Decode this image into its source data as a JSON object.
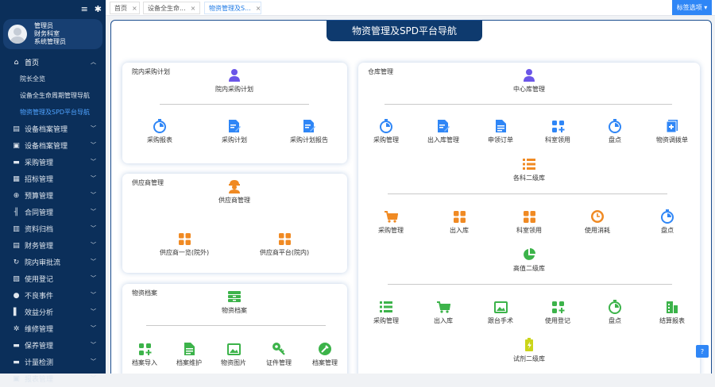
{
  "sidebar": {
    "user": {
      "name": "管理员",
      "dept": "财务科室",
      "role": "系统管理员"
    },
    "items": [
      {
        "label": "首页",
        "icon": "home-icon",
        "glyph": "⌂"
      },
      {
        "label": "设备档案管理",
        "icon": "archive-icon",
        "glyph": "▤"
      },
      {
        "label": "设备档案管理",
        "icon": "file-icon",
        "glyph": "▣"
      },
      {
        "label": "采购管理",
        "icon": "cart-icon",
        "glyph": "▬"
      },
      {
        "label": "招标管理",
        "icon": "gavel-icon",
        "glyph": "▦"
      },
      {
        "label": "预算管理",
        "icon": "budget-icon",
        "glyph": "⊕"
      },
      {
        "label": "合同管理",
        "icon": "contract-icon",
        "glyph": "╢"
      },
      {
        "label": "资料归档",
        "icon": "folder-icon",
        "glyph": "▥"
      },
      {
        "label": "财务管理",
        "icon": "finance-icon",
        "glyph": "▤"
      },
      {
        "label": "院内审批流",
        "icon": "flow-icon",
        "glyph": "↻"
      },
      {
        "label": "使用登记",
        "icon": "register-icon",
        "glyph": "▧"
      },
      {
        "label": "不良事件",
        "icon": "alert-icon",
        "glyph": "●"
      },
      {
        "label": "效益分析",
        "icon": "chart-icon",
        "glyph": "▌"
      },
      {
        "label": "维修管理",
        "icon": "wrench-icon",
        "glyph": "✲"
      },
      {
        "label": "保养管理",
        "icon": "maintain-icon",
        "glyph": "▬"
      },
      {
        "label": "计量检测",
        "icon": "measure-icon",
        "glyph": "▬"
      },
      {
        "label": "报表管理",
        "icon": "report-icon",
        "glyph": "▣"
      }
    ],
    "home_subs": [
      {
        "label": "院长全览"
      },
      {
        "label": "设备全生命周期管理导航"
      },
      {
        "label": "物资管理及SPD平台导航"
      }
    ]
  },
  "tabs": [
    {
      "label": "首页"
    },
    {
      "label": "设备全生命..."
    },
    {
      "label": "物资管理及S..."
    }
  ],
  "top_button": "标签选项",
  "page_title": "物资管理及SPD平台导航",
  "help_label": "帮助",
  "colors": {
    "blue": "#2f86f6",
    "purple": "#6b56e8",
    "orange": "#f08a23",
    "green": "#3cb34a",
    "yellow": "#cbd51a",
    "sidebar": "#0b2f5a"
  },
  "cards": {
    "plan": {
      "title": "院内采购计划",
      "head": {
        "label": "院内采购计划",
        "icon": "user-icon"
      },
      "row": [
        {
          "label": "采购报表",
          "icon": "timer-icon"
        },
        {
          "label": "采购计划",
          "icon": "doc-edit-icon"
        },
        {
          "label": "采购计划报告",
          "icon": "doc-edit-icon"
        }
      ]
    },
    "supplier": {
      "title": "供应商管理",
      "head": {
        "label": "供应商管理",
        "icon": "worker-icon"
      },
      "row": [
        {
          "label": "供应商一览(院外)",
          "icon": "grid-icon"
        },
        {
          "label": "供应商平台(院内)",
          "icon": "grid-icon"
        }
      ]
    },
    "dict": {
      "title": "物资档案",
      "head": {
        "label": "物资档案",
        "icon": "archive-box-icon"
      },
      "row": [
        {
          "label": "档案导入",
          "icon": "apps-icon"
        },
        {
          "label": "档案维护",
          "icon": "doc-icon"
        },
        {
          "label": "物资图片",
          "icon": "image-icon"
        },
        {
          "label": "证件管理",
          "icon": "key-icon"
        },
        {
          "label": "档案管理",
          "icon": "tool-icon"
        }
      ]
    },
    "warehouse": {
      "title": "仓库管理",
      "head": {
        "label": "中心库管理",
        "icon": "user-icon"
      },
      "row1": [
        {
          "label": "采购管理",
          "icon": "timer-icon"
        },
        {
          "label": "出入库管理",
          "icon": "doc-edit-icon"
        },
        {
          "label": "申领订单",
          "icon": "doc-icon"
        },
        {
          "label": "科室领用",
          "icon": "apps-icon"
        },
        {
          "label": "盘点",
          "icon": "timer-icon"
        },
        {
          "label": "物资调拨单",
          "icon": "plus-doc-icon"
        }
      ],
      "sec2": {
        "label": "各科二级库",
        "icon": "list-icon"
      },
      "row2": [
        {
          "label": "采购管理",
          "icon": "cart-icon"
        },
        {
          "label": "出入库",
          "icon": "grid-icon"
        },
        {
          "label": "科室领用",
          "icon": "grid-icon"
        },
        {
          "label": "使用消耗",
          "icon": "clock-icon"
        },
        {
          "label": "盘点",
          "icon": "timer-icon"
        }
      ],
      "sec3": {
        "label": "高值二级库",
        "icon": "pie-icon"
      },
      "row3": [
        {
          "label": "采购管理",
          "icon": "list-icon"
        },
        {
          "label": "出入库",
          "icon": "cart-icon"
        },
        {
          "label": "跟台手术",
          "icon": "image-icon"
        },
        {
          "label": "使用登记",
          "icon": "apps-icon"
        },
        {
          "label": "盘点",
          "icon": "timer-icon"
        },
        {
          "label": "结算报表",
          "icon": "building-icon"
        }
      ],
      "sec4": {
        "label": "试剂二级库",
        "icon": "battery-icon"
      }
    }
  }
}
